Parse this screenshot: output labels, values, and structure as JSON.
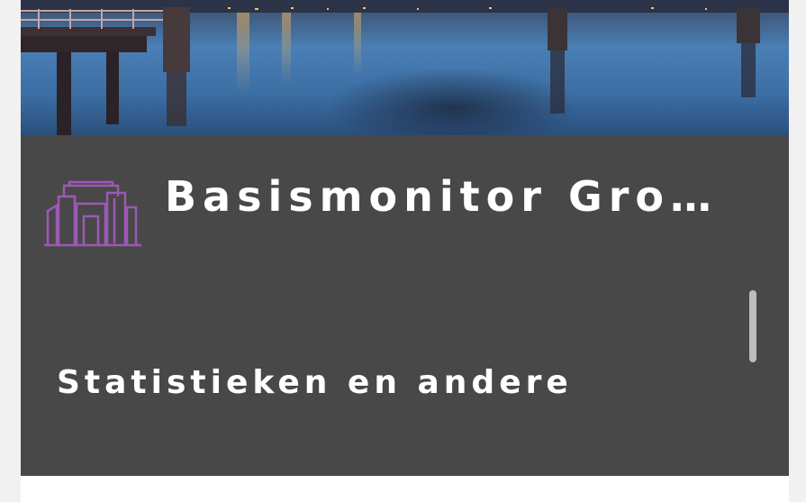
{
  "app": {
    "title": "Basismonitor Gro…",
    "subtitle": "Statistieken en andere"
  },
  "icons": {
    "logo": "city-buildings-icon",
    "hero": "harbor-pier-night-photo"
  },
  "colors": {
    "panel": "#484848",
    "logo_accent": "#9b59b6",
    "text": "#ffffff",
    "scrollbar": "#bdbdbd"
  }
}
